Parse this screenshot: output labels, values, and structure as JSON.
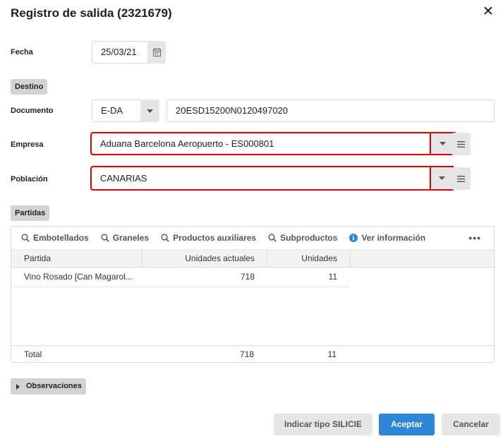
{
  "dialog": {
    "title": "Registro de salida (2321679)"
  },
  "fecha": {
    "label": "Fecha",
    "value": "25/03/21"
  },
  "destino": {
    "section_label": "Destino",
    "documento": {
      "label": "Documento",
      "type_value": "E-DA",
      "number_value": "20ESD15200N0120497020"
    },
    "empresa": {
      "label": "Empresa",
      "value": "Aduana Barcelona Aeropuerto - ES000801"
    },
    "poblacion": {
      "label": "Población",
      "value": "CANARIAS"
    }
  },
  "partidas": {
    "section_label": "Partidas",
    "toolbar": [
      {
        "label": "Embotellados",
        "icon": "search-icon"
      },
      {
        "label": "Graneles",
        "icon": "search-icon"
      },
      {
        "label": "Productos auxiliares",
        "icon": "search-icon"
      },
      {
        "label": "Subproductos",
        "icon": "search-icon"
      },
      {
        "label": "Ver información",
        "icon": "info-icon"
      }
    ],
    "columns": [
      "Partida",
      "Unidades actuales",
      "Unidades"
    ],
    "rows": [
      {
        "partida": "Vino Rosado [Can Magarol...",
        "unidades_actuales": "718",
        "unidades": "11"
      }
    ],
    "total": {
      "label": "Total",
      "unidades_actuales": "718",
      "unidades": "11"
    }
  },
  "observaciones": {
    "label": "Observaciones"
  },
  "buttons": {
    "silicie": "Indicar tipo SILICIE",
    "accept": "Aceptar",
    "cancel": "Cancelar"
  },
  "colors": {
    "accent": "#2e86d6",
    "highlight": "#e00000",
    "button_gray": "#e6e6e6"
  }
}
